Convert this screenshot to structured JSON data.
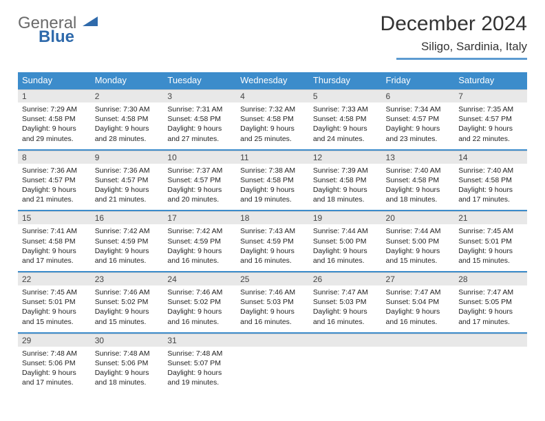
{
  "brand": {
    "line1": "General",
    "line2": "Blue"
  },
  "title": {
    "month": "December 2024",
    "location": "Siligo, Sardinia, Italy"
  },
  "day_headers": [
    "Sunday",
    "Monday",
    "Tuesday",
    "Wednesday",
    "Thursday",
    "Friday",
    "Saturday"
  ],
  "weeks": [
    [
      {
        "n": "1",
        "sr": "Sunrise: 7:29 AM",
        "ss": "Sunset: 4:58 PM",
        "d1": "Daylight: 9 hours",
        "d2": "and 29 minutes."
      },
      {
        "n": "2",
        "sr": "Sunrise: 7:30 AM",
        "ss": "Sunset: 4:58 PM",
        "d1": "Daylight: 9 hours",
        "d2": "and 28 minutes."
      },
      {
        "n": "3",
        "sr": "Sunrise: 7:31 AM",
        "ss": "Sunset: 4:58 PM",
        "d1": "Daylight: 9 hours",
        "d2": "and 27 minutes."
      },
      {
        "n": "4",
        "sr": "Sunrise: 7:32 AM",
        "ss": "Sunset: 4:58 PM",
        "d1": "Daylight: 9 hours",
        "d2": "and 25 minutes."
      },
      {
        "n": "5",
        "sr": "Sunrise: 7:33 AM",
        "ss": "Sunset: 4:58 PM",
        "d1": "Daylight: 9 hours",
        "d2": "and 24 minutes."
      },
      {
        "n": "6",
        "sr": "Sunrise: 7:34 AM",
        "ss": "Sunset: 4:57 PM",
        "d1": "Daylight: 9 hours",
        "d2": "and 23 minutes."
      },
      {
        "n": "7",
        "sr": "Sunrise: 7:35 AM",
        "ss": "Sunset: 4:57 PM",
        "d1": "Daylight: 9 hours",
        "d2": "and 22 minutes."
      }
    ],
    [
      {
        "n": "8",
        "sr": "Sunrise: 7:36 AM",
        "ss": "Sunset: 4:57 PM",
        "d1": "Daylight: 9 hours",
        "d2": "and 21 minutes."
      },
      {
        "n": "9",
        "sr": "Sunrise: 7:36 AM",
        "ss": "Sunset: 4:57 PM",
        "d1": "Daylight: 9 hours",
        "d2": "and 21 minutes."
      },
      {
        "n": "10",
        "sr": "Sunrise: 7:37 AM",
        "ss": "Sunset: 4:57 PM",
        "d1": "Daylight: 9 hours",
        "d2": "and 20 minutes."
      },
      {
        "n": "11",
        "sr": "Sunrise: 7:38 AM",
        "ss": "Sunset: 4:58 PM",
        "d1": "Daylight: 9 hours",
        "d2": "and 19 minutes."
      },
      {
        "n": "12",
        "sr": "Sunrise: 7:39 AM",
        "ss": "Sunset: 4:58 PM",
        "d1": "Daylight: 9 hours",
        "d2": "and 18 minutes."
      },
      {
        "n": "13",
        "sr": "Sunrise: 7:40 AM",
        "ss": "Sunset: 4:58 PM",
        "d1": "Daylight: 9 hours",
        "d2": "and 18 minutes."
      },
      {
        "n": "14",
        "sr": "Sunrise: 7:40 AM",
        "ss": "Sunset: 4:58 PM",
        "d1": "Daylight: 9 hours",
        "d2": "and 17 minutes."
      }
    ],
    [
      {
        "n": "15",
        "sr": "Sunrise: 7:41 AM",
        "ss": "Sunset: 4:58 PM",
        "d1": "Daylight: 9 hours",
        "d2": "and 17 minutes."
      },
      {
        "n": "16",
        "sr": "Sunrise: 7:42 AM",
        "ss": "Sunset: 4:59 PM",
        "d1": "Daylight: 9 hours",
        "d2": "and 16 minutes."
      },
      {
        "n": "17",
        "sr": "Sunrise: 7:42 AM",
        "ss": "Sunset: 4:59 PM",
        "d1": "Daylight: 9 hours",
        "d2": "and 16 minutes."
      },
      {
        "n": "18",
        "sr": "Sunrise: 7:43 AM",
        "ss": "Sunset: 4:59 PM",
        "d1": "Daylight: 9 hours",
        "d2": "and 16 minutes."
      },
      {
        "n": "19",
        "sr": "Sunrise: 7:44 AM",
        "ss": "Sunset: 5:00 PM",
        "d1": "Daylight: 9 hours",
        "d2": "and 16 minutes."
      },
      {
        "n": "20",
        "sr": "Sunrise: 7:44 AM",
        "ss": "Sunset: 5:00 PM",
        "d1": "Daylight: 9 hours",
        "d2": "and 15 minutes."
      },
      {
        "n": "21",
        "sr": "Sunrise: 7:45 AM",
        "ss": "Sunset: 5:01 PM",
        "d1": "Daylight: 9 hours",
        "d2": "and 15 minutes."
      }
    ],
    [
      {
        "n": "22",
        "sr": "Sunrise: 7:45 AM",
        "ss": "Sunset: 5:01 PM",
        "d1": "Daylight: 9 hours",
        "d2": "and 15 minutes."
      },
      {
        "n": "23",
        "sr": "Sunrise: 7:46 AM",
        "ss": "Sunset: 5:02 PM",
        "d1": "Daylight: 9 hours",
        "d2": "and 15 minutes."
      },
      {
        "n": "24",
        "sr": "Sunrise: 7:46 AM",
        "ss": "Sunset: 5:02 PM",
        "d1": "Daylight: 9 hours",
        "d2": "and 16 minutes."
      },
      {
        "n": "25",
        "sr": "Sunrise: 7:46 AM",
        "ss": "Sunset: 5:03 PM",
        "d1": "Daylight: 9 hours",
        "d2": "and 16 minutes."
      },
      {
        "n": "26",
        "sr": "Sunrise: 7:47 AM",
        "ss": "Sunset: 5:03 PM",
        "d1": "Daylight: 9 hours",
        "d2": "and 16 minutes."
      },
      {
        "n": "27",
        "sr": "Sunrise: 7:47 AM",
        "ss": "Sunset: 5:04 PM",
        "d1": "Daylight: 9 hours",
        "d2": "and 16 minutes."
      },
      {
        "n": "28",
        "sr": "Sunrise: 7:47 AM",
        "ss": "Sunset: 5:05 PM",
        "d1": "Daylight: 9 hours",
        "d2": "and 17 minutes."
      }
    ],
    [
      {
        "n": "29",
        "sr": "Sunrise: 7:48 AM",
        "ss": "Sunset: 5:06 PM",
        "d1": "Daylight: 9 hours",
        "d2": "and 17 minutes."
      },
      {
        "n": "30",
        "sr": "Sunrise: 7:48 AM",
        "ss": "Sunset: 5:06 PM",
        "d1": "Daylight: 9 hours",
        "d2": "and 18 minutes."
      },
      {
        "n": "31",
        "sr": "Sunrise: 7:48 AM",
        "ss": "Sunset: 5:07 PM",
        "d1": "Daylight: 9 hours",
        "d2": "and 19 minutes."
      },
      {
        "empty": true
      },
      {
        "empty": true
      },
      {
        "empty": true
      },
      {
        "empty": true
      }
    ]
  ]
}
